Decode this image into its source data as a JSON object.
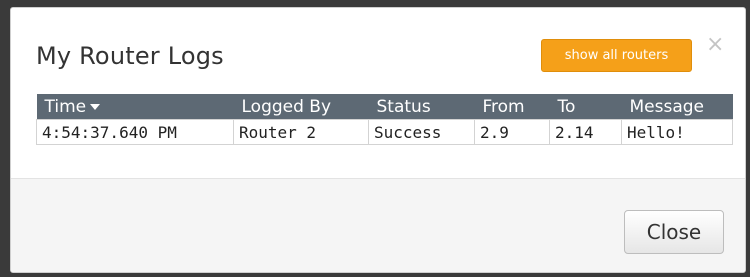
{
  "dialog": {
    "title": "My Router Logs",
    "show_all_label": "show all routers",
    "close_x": "×",
    "close_label": "Close"
  },
  "table": {
    "headers": [
      "Time",
      "Logged By",
      "Status",
      "From",
      "To",
      "Message"
    ],
    "sorted_column": "Time",
    "sort_direction": "descending",
    "rows": [
      [
        "4:54:37.640 PM",
        "Router 2",
        "Success",
        "2.9",
        "2.14",
        "Hello!"
      ]
    ]
  },
  "colors": {
    "accent_button": "#f5a019",
    "table_header": "#5d6974"
  }
}
